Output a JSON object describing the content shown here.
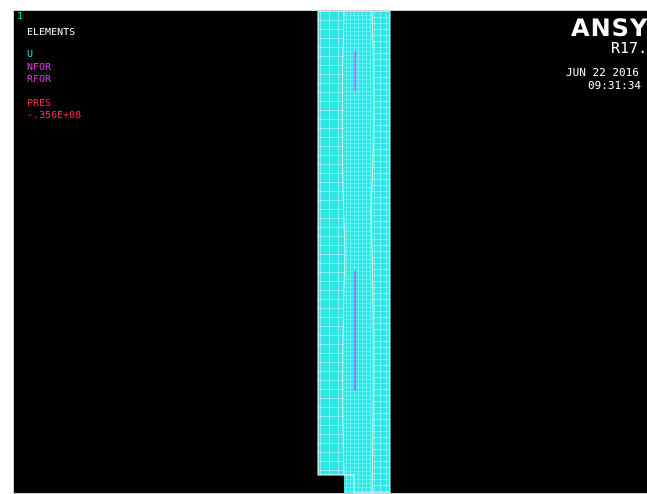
{
  "window": {
    "number": "1"
  },
  "legend": {
    "title": "ELEMENTS",
    "items": [
      {
        "label": "U",
        "color": "#00e5e5"
      },
      {
        "label": "NFOR",
        "color": "#e040e0"
      },
      {
        "label": "RFOR",
        "color": "#e040e0"
      },
      {
        "label": "PRES",
        "color": "#ff3030"
      },
      {
        "label": "-.356E+08",
        "color": "#ff3030"
      }
    ]
  },
  "branding": {
    "logo": "ANSYS",
    "release": "R17.",
    "date": "JUN 22 2016",
    "time": "09:31:34"
  },
  "colors": {
    "background": "#000000",
    "mesh_fill": "#2ee6e6",
    "mesh_lines": "#ffffff",
    "load_marker": "#c040ff"
  }
}
